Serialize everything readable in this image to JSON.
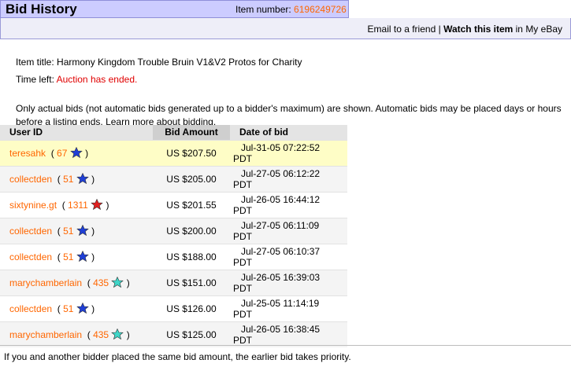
{
  "header": {
    "title": "Bid History",
    "item_number_label": "Item number:",
    "item_number": "6196249726"
  },
  "actions": {
    "email": "Email to a friend",
    "separator": "|",
    "watch": "Watch this item",
    "watch_suffix": "in My eBay"
  },
  "item": {
    "title_label": "Item title:",
    "title": "Harmony Kingdom Trouble Bruin V1&V2 Protos for Charity",
    "time_left_label": "Time left:",
    "time_left": "Auction has ended."
  },
  "note": "Only actual bids (not automatic bids generated up to a bidder's maximum) are shown. Automatic bids may be placed days or hours before a listing ends. Learn more about bidding.",
  "table": {
    "columns": [
      "User ID",
      "Bid Amount",
      "Date of bid"
    ],
    "rows": [
      {
        "user": "teresahk",
        "score": "67",
        "star": "blue",
        "amount": "US $207.50",
        "date": "Jul-31-05 07:22:52",
        "tz": "PDT"
      },
      {
        "user": "collectden",
        "score": "51",
        "star": "blue",
        "amount": "US $205.00",
        "date": "Jul-27-05 06:12:22",
        "tz": "PDT"
      },
      {
        "user": "sixtynine.gt",
        "score": "1311",
        "star": "red",
        "amount": "US $201.55",
        "date": "Jul-26-05 16:44:12",
        "tz": "PDT"
      },
      {
        "user": "collectden",
        "score": "51",
        "star": "blue",
        "amount": "US $200.00",
        "date": "Jul-27-05 06:11:09",
        "tz": "PDT"
      },
      {
        "user": "collectden",
        "score": "51",
        "star": "blue",
        "amount": "US $188.00",
        "date": "Jul-27-05 06:10:37",
        "tz": "PDT"
      },
      {
        "user": "marychamberlain",
        "score": "435",
        "star": "turquoise",
        "amount": "US $151.00",
        "date": "Jul-26-05 16:39:03",
        "tz": "PDT"
      },
      {
        "user": "collectden",
        "score": "51",
        "star": "blue",
        "amount": "US $126.00",
        "date": "Jul-25-05 11:14:19",
        "tz": "PDT"
      },
      {
        "user": "marychamberlain",
        "score": "435",
        "star": "turquoise",
        "amount": "US $125.00",
        "date": "Jul-26-05 16:38:45",
        "tz": "PDT"
      }
    ]
  },
  "footer": "If you and another bidder placed the same bid amount, the earlier bid takes priority.",
  "colors": {
    "blue": "#1f3fd6",
    "red": "#e02020",
    "turquoise": "#3fd6c8",
    "link": "#ff6600"
  }
}
